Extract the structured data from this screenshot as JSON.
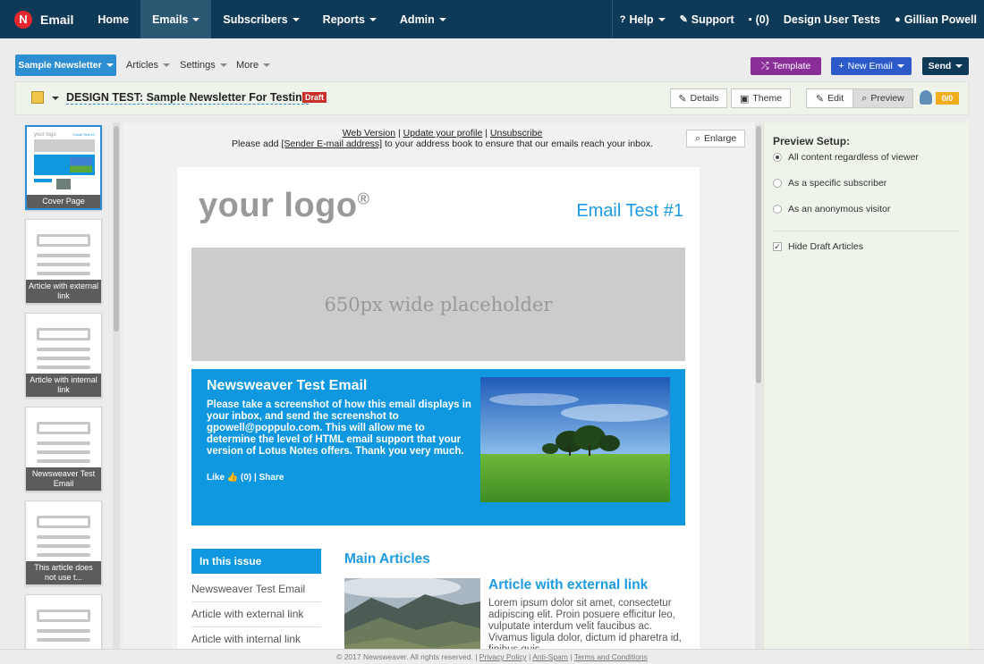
{
  "topnav": {
    "brand_logo": "N",
    "brand": "Email",
    "items": [
      {
        "label": "Home"
      },
      {
        "label": "Emails"
      },
      {
        "label": "Subscribers"
      },
      {
        "label": "Reports"
      },
      {
        "label": "Admin"
      }
    ],
    "right": {
      "help": "Help",
      "support": "Support",
      "messages": "(0)",
      "account": "Design User Tests",
      "user": "Gillian Powell"
    }
  },
  "subbar": {
    "newsletter": "Sample Newsletter",
    "menus": [
      "Articles",
      "Settings",
      "More"
    ],
    "template": "Template",
    "new_email": "New Email",
    "send": "Send"
  },
  "titlebar": {
    "title": "DESIGN TEST: Sample Newsletter For Testing",
    "badge": "Draft",
    "details": "Details",
    "theme": "Theme",
    "edit": "Edit",
    "preview": "Preview",
    "count": "0/0"
  },
  "sidebar": {
    "thumbs": [
      {
        "label": "Cover Page"
      },
      {
        "label": "Article with external link"
      },
      {
        "label": "Article with internal link"
      },
      {
        "label": "Newsweaver Test Email"
      },
      {
        "label": "This article does not use t..."
      },
      {
        "label": ""
      }
    ],
    "cover_logo": "your logo",
    "cover_title": "Email Test #1"
  },
  "preview": {
    "links": {
      "web": "Web Version",
      "profile": "Update your profile",
      "unsub": "Unsubscribe",
      "sep": "|"
    },
    "notice_pre": "Please add ",
    "notice_link": "[Sender E-mail address]",
    "notice_post": " to your address book to ensure that our emails reach your inbox.",
    "enlarge": "Enlarge"
  },
  "email": {
    "logo": "your logo",
    "logo_mark": "®",
    "title": "Email Test #1",
    "placeholder": "650px wide placeholder",
    "feature_title": "Newsweaver Test Email",
    "feature_body": "Please take a screenshot of how this email displays in your inbox, and send the screenshot to gpowell@poppulo.com. This will allow me to determine the level of HTML email support that your version of Lotus Notes offers. Thank you very much.",
    "like": "Like",
    "like_count": "(0)",
    "share": "Share",
    "issue_head": "In this issue",
    "issue_items": [
      "Newsweaver Test Email",
      "Article with external link",
      "Article with internal link"
    ],
    "main_head": "Main Articles",
    "article_title": "Article with external link",
    "article_body": "Lorem ipsum dolor sit amet, consectetur adipiscing elit. Proin posuere efficitur leo, vulputate interdum velit faucibus ac. Vivamus ligula dolor, dictum id pharetra id, finibus quis ..."
  },
  "rpanel": {
    "title": "Preview Setup:",
    "options": [
      "All content regardless of viewer",
      "As a specific subscriber",
      "As an anonymous visitor"
    ],
    "selected": 0,
    "hide_drafts": "Hide Draft Articles"
  },
  "footer": {
    "copyright": "© 2017 Newsweaver. All rights reserved.",
    "privacy": "Privacy Policy",
    "antispam": "Anti-Spam",
    "terms": "Terms and Conditions",
    "sep": "|"
  },
  "colors": {
    "nav": "#0f3a57",
    "accent": "#1e9be0",
    "template": "#8b2d99",
    "new_email": "#2c5bc9",
    "draft": "#c9302c"
  }
}
